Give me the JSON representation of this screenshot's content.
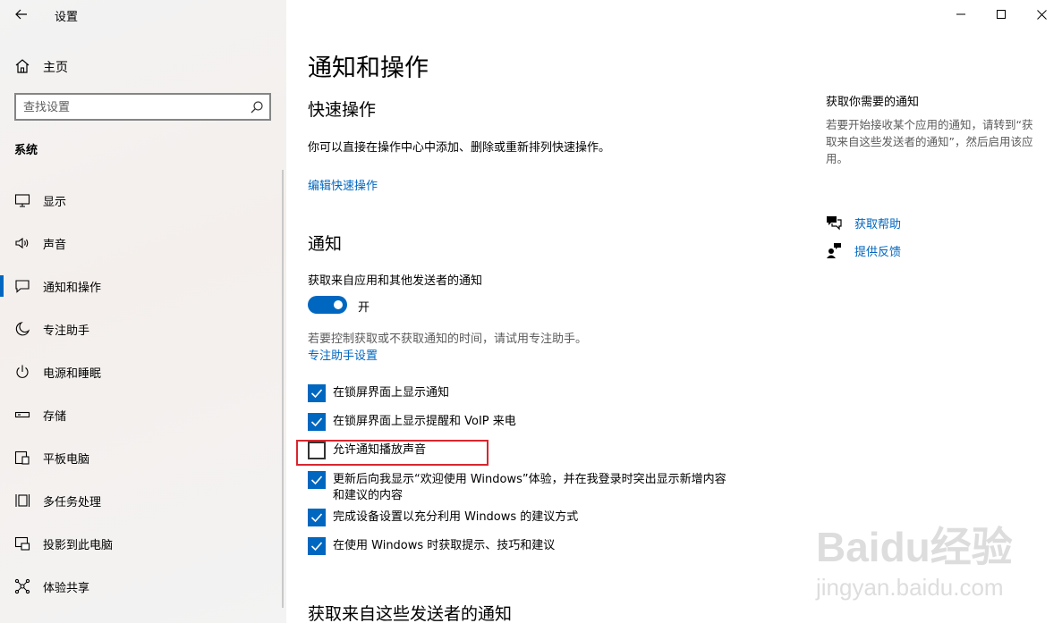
{
  "app": {
    "title": "设置"
  },
  "sidebar": {
    "home_label": "主页",
    "search_placeholder": "查找设置",
    "section_label": "系统",
    "items": [
      {
        "label": "显示",
        "icon": "monitor-icon"
      },
      {
        "label": "声音",
        "icon": "speaker-icon"
      },
      {
        "label": "通知和操作",
        "icon": "notification-icon",
        "active": true
      },
      {
        "label": "专注助手",
        "icon": "moon-icon"
      },
      {
        "label": "电源和睡眠",
        "icon": "power-icon"
      },
      {
        "label": "存储",
        "icon": "storage-icon"
      },
      {
        "label": "平板电脑",
        "icon": "tablet-icon"
      },
      {
        "label": "多任务处理",
        "icon": "multitask-icon"
      },
      {
        "label": "投影到此电脑",
        "icon": "project-icon"
      },
      {
        "label": "体验共享",
        "icon": "share-icon"
      }
    ]
  },
  "main": {
    "title": "通知和操作",
    "quick_actions": {
      "heading": "快速操作",
      "description": "你可以直接在操作中心中添加、删除或重新排列快速操作。",
      "edit_link": "编辑快速操作"
    },
    "notifications": {
      "heading": "通知",
      "get_label": "获取来自应用和其他发送者的通知",
      "toggle_state": "开",
      "toggle_on": true,
      "focus_hint": "若要控制获取或不获取通知的时间，请试用专注助手。",
      "focus_link": "专注助手设置",
      "checkboxes": [
        {
          "label": "在锁屏界面上显示通知",
          "checked": true
        },
        {
          "label": "在锁屏界面上显示提醒和 VoIP 来电",
          "checked": true
        },
        {
          "label": "允许通知播放声音",
          "checked": false
        },
        {
          "label": "更新后向我显示“欢迎使用 Windows”体验，并在我登录时突出显示新增内容和建议的内容",
          "checked": true
        },
        {
          "label": "完成设备设置以充分利用 Windows 的建议方式",
          "checked": true
        },
        {
          "label": "在使用 Windows 时获取提示、技巧和建议",
          "checked": true
        }
      ]
    },
    "senders_heading": "获取来自这些发送者的通知"
  },
  "right": {
    "title": "获取你需要的通知",
    "description": "若要开始接收某个应用的通知，请转到“获取来自这些发送者的通知”，然后启用该应用。",
    "help_link": "获取帮助",
    "feedback_link": "提供反馈"
  },
  "watermark": {
    "line1": "Baidu经验",
    "line2": "jingyan.baidu.com"
  },
  "colors": {
    "accent": "#0067c0",
    "highlight": "#d9262f"
  }
}
